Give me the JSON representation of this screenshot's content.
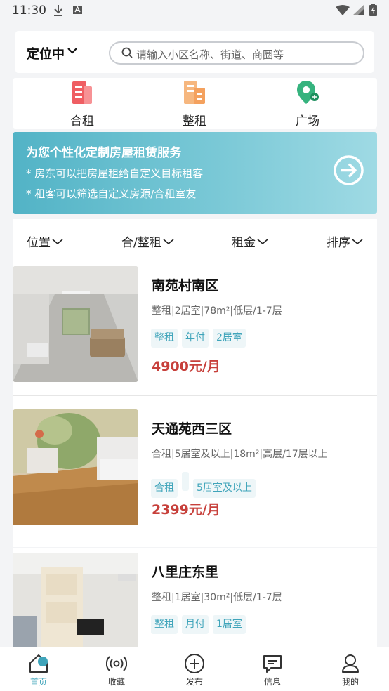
{
  "status_bar": {
    "time": "11:30"
  },
  "search": {
    "location_label": "定位中",
    "placeholder": "请输入小区名称、街道、商圈等"
  },
  "categories": [
    {
      "label": "合租",
      "icon": "shared-rent-icon",
      "color": "#ef5e63"
    },
    {
      "label": "整租",
      "icon": "whole-rent-icon",
      "color": "#f4a15e"
    },
    {
      "label": "广场",
      "icon": "location-pin-icon",
      "color": "#36b37e"
    }
  ],
  "banner": {
    "title": "为您个性化定制房屋租赁服务",
    "lines": [
      "* 房东可以把房屋租给自定义目标租客",
      "* 租客可以筛选自定义房源/合租室友"
    ]
  },
  "filters": [
    "位置",
    "合/整租",
    "租金",
    "排序"
  ],
  "listings": [
    {
      "title": "南苑村南区",
      "specs": "整租|2居室|78m²|低层/1-7层",
      "tags": [
        "整租",
        "年付",
        "2居室"
      ],
      "price": "4900元/月"
    },
    {
      "title": "天通苑西三区",
      "specs": "合租|5居室及以上|18m²|高层/17层以上",
      "tags": [
        "合租",
        "",
        "5居室及以上"
      ],
      "price": "2399元/月"
    },
    {
      "title": "八里庄东里",
      "specs": "整租|1居室|30m²|低层/1-7层",
      "tags": [
        "整租",
        "月付",
        "1居室"
      ],
      "price": ""
    }
  ],
  "tabbar": [
    {
      "label": "首页",
      "icon": "home-icon",
      "active": true
    },
    {
      "label": "收藏",
      "icon": "broadcast-icon",
      "active": false
    },
    {
      "label": "发布",
      "icon": "add-circle-icon",
      "active": false
    },
    {
      "label": "信息",
      "icon": "message-icon",
      "active": false
    },
    {
      "label": "我的",
      "icon": "profile-icon",
      "active": false
    }
  ],
  "colors": {
    "accent": "#3fa4ba",
    "price": "#c7403b",
    "tag_bg": "#eef6f8"
  }
}
